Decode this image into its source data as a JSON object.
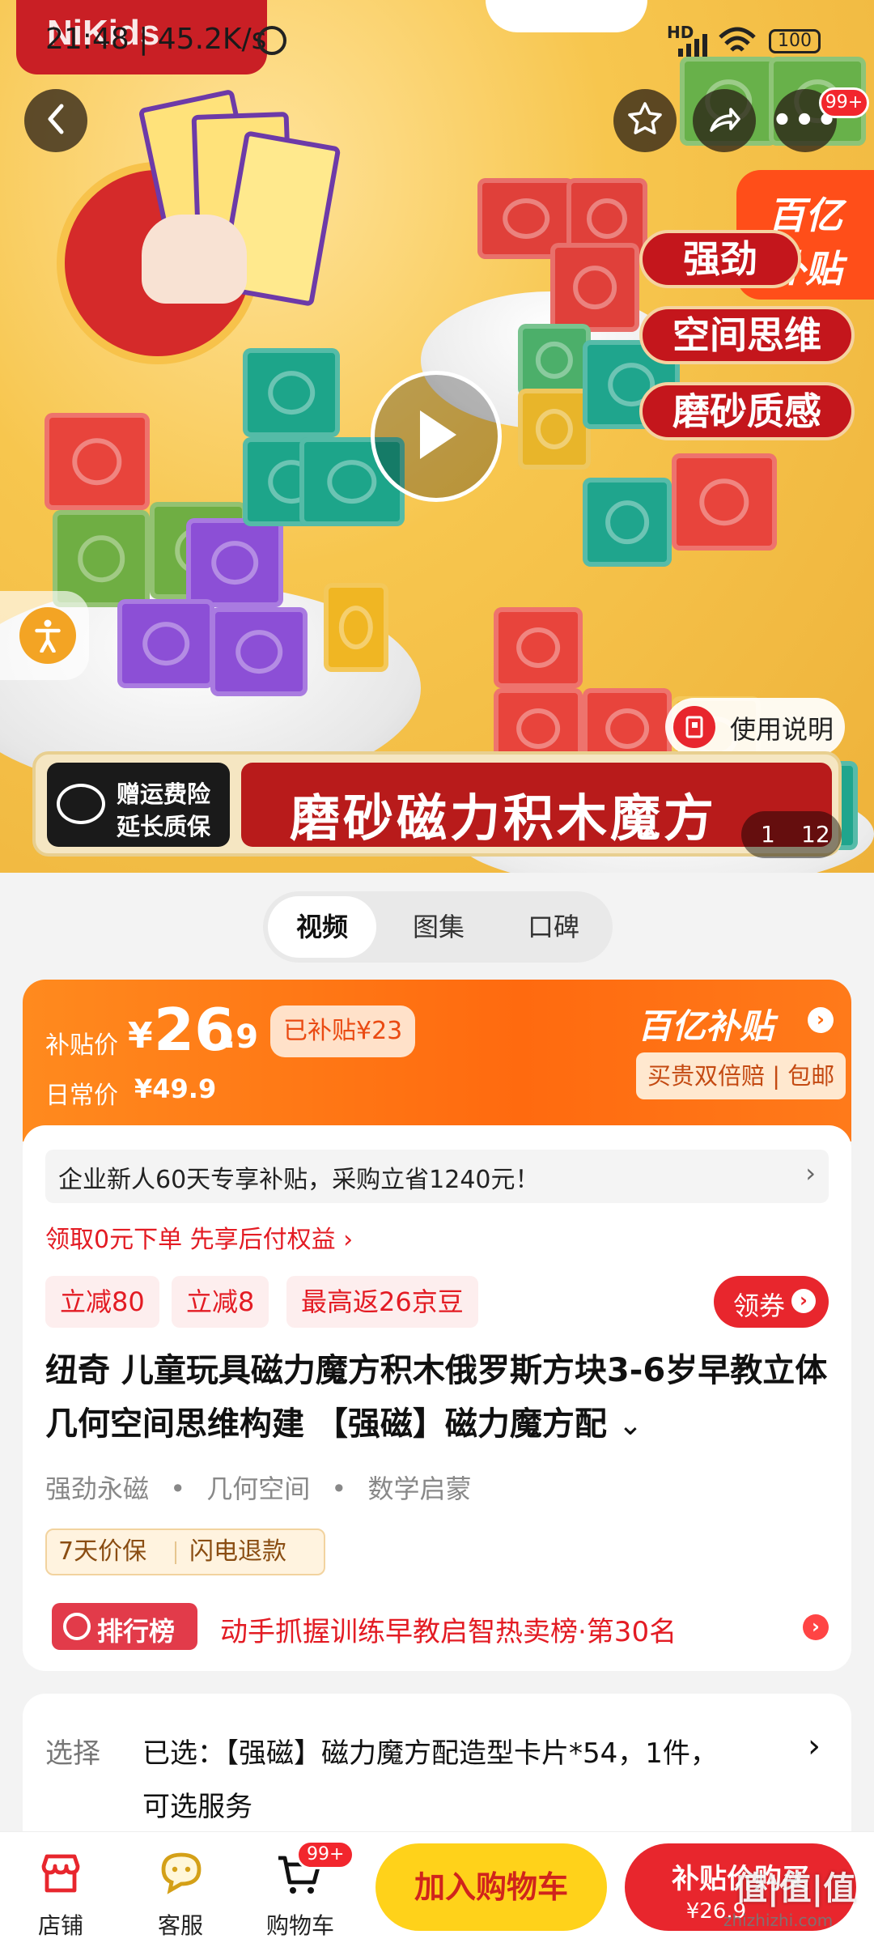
{
  "status_bar": {
    "time": "21:48 | 45.2K/s",
    "network": "HD",
    "battery": "100"
  },
  "brand": {
    "logo_text": "NiKids"
  },
  "hero": {
    "tags": [
      "强劲",
      "空间思维",
      "磨砂质感"
    ],
    "subsidy_badge": {
      "line1": "百亿",
      "line2": "补贴"
    },
    "banner_left": {
      "line1": "赠运费险",
      "line2": "延长质保"
    },
    "banner_title": "磨砂磁力积木魔方",
    "manual_label": "使用说明",
    "page_current": "1",
    "page_total": "12",
    "badge_count": "99+"
  },
  "tabs": [
    "视频",
    "图集",
    "口碑"
  ],
  "price": {
    "label": "补贴价",
    "currency": "¥",
    "integer": "26",
    "decimal": ".9",
    "subsidy_tag": "已补贴¥23",
    "daily_label": "日常价",
    "daily_value": "¥49.9",
    "program": "百亿补贴",
    "guarantee": "买贵双倍赔 | 包邮"
  },
  "promo": {
    "enterprise": "企业新人60天专享补贴，采购立省1240元！",
    "pay_later": "领取0元下单 先享后付权益 ›",
    "chips": [
      "立减80",
      "立减8",
      "最高返26京豆"
    ],
    "coupon_btn": "领券"
  },
  "product": {
    "title": "纽奇 儿童玩具磁力魔方积木俄罗斯方块3-6岁早教立体几何空间思维构建 【强磁】磁力魔方配",
    "features": [
      "强劲永磁",
      "几何空间",
      "数学启蒙"
    ],
    "services": [
      "7天价保",
      "闪电退款"
    ],
    "rank_badge": "排行榜",
    "rank_text": "动手抓握训练早教启智热卖榜·第30名"
  },
  "selection": {
    "label": "选择",
    "value_line1": "已选：【强磁】磁力魔方配造型卡片*54，1件，",
    "value_line2": "可选服务"
  },
  "bottom_bar": {
    "store": "店铺",
    "service": "客服",
    "cart": "购物车",
    "cart_badge": "99+",
    "add_cart": "加入购物车",
    "buy_line1": "补贴价购买",
    "buy_line2": "¥26.9"
  },
  "watermark": {
    "text": "值|值|值",
    "site": "zhizhizhi.com"
  },
  "colors": {
    "brand_red": "#c91f25",
    "orange": "#ff6a0f",
    "yellow": "#ffd21a",
    "cta_red": "#e8262d"
  }
}
